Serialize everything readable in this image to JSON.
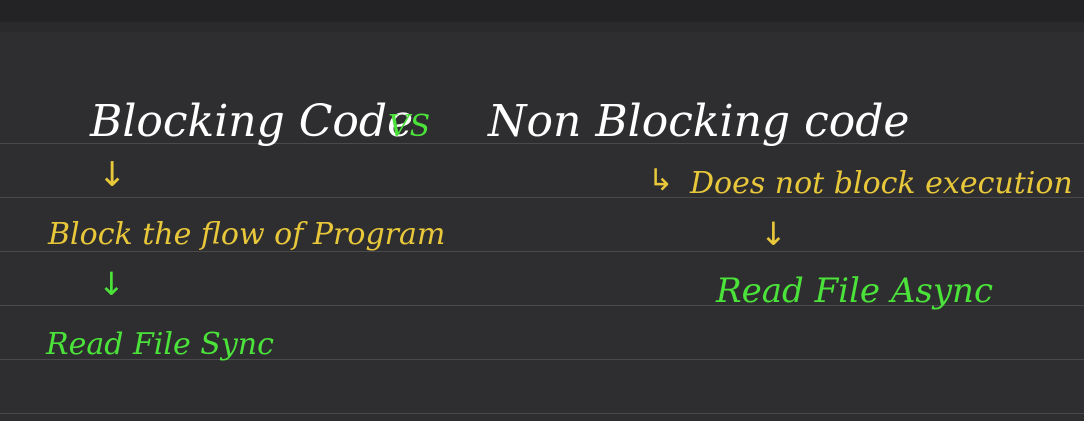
{
  "notes": {
    "heading_left": "Blocking Code",
    "heading_vs": "VS",
    "heading_right": "Non Blocking code",
    "left_point": "Block the flow of Program",
    "left_example": "Read File Sync",
    "right_point": "Does not block execution",
    "right_example": "Read File Async"
  },
  "arrows": {
    "down": "↓",
    "elbow": "↳"
  },
  "colors": {
    "background": "#2e2e30",
    "ruled_line": "#4a4a4d",
    "heading": "#ffffff",
    "vs": "#4be33a",
    "description": "#e8c83a",
    "example": "#4be33a"
  }
}
